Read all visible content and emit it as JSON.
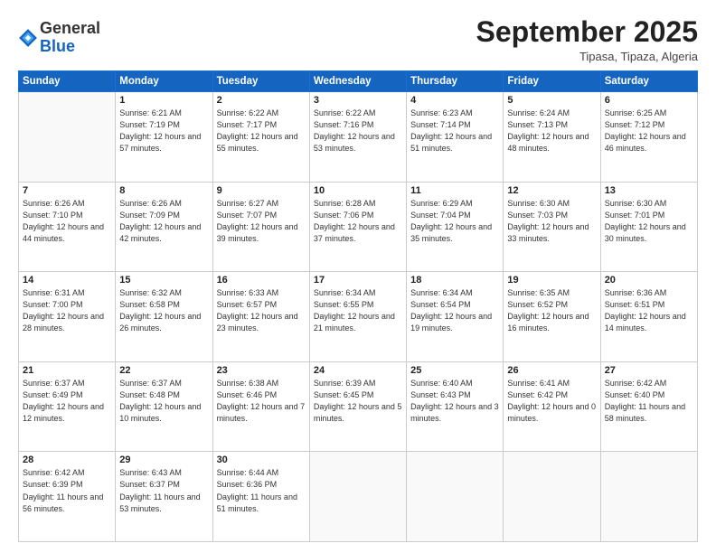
{
  "header": {
    "logo_general": "General",
    "logo_blue": "Blue",
    "month": "September 2025",
    "location": "Tipasa, Tipaza, Algeria"
  },
  "weekdays": [
    "Sunday",
    "Monday",
    "Tuesday",
    "Wednesday",
    "Thursday",
    "Friday",
    "Saturday"
  ],
  "weeks": [
    [
      {
        "day": "",
        "info": ""
      },
      {
        "day": "1",
        "info": "Sunrise: 6:21 AM\nSunset: 7:19 PM\nDaylight: 12 hours\nand 57 minutes."
      },
      {
        "day": "2",
        "info": "Sunrise: 6:22 AM\nSunset: 7:17 PM\nDaylight: 12 hours\nand 55 minutes."
      },
      {
        "day": "3",
        "info": "Sunrise: 6:22 AM\nSunset: 7:16 PM\nDaylight: 12 hours\nand 53 minutes."
      },
      {
        "day": "4",
        "info": "Sunrise: 6:23 AM\nSunset: 7:14 PM\nDaylight: 12 hours\nand 51 minutes."
      },
      {
        "day": "5",
        "info": "Sunrise: 6:24 AM\nSunset: 7:13 PM\nDaylight: 12 hours\nand 48 minutes."
      },
      {
        "day": "6",
        "info": "Sunrise: 6:25 AM\nSunset: 7:12 PM\nDaylight: 12 hours\nand 46 minutes."
      }
    ],
    [
      {
        "day": "7",
        "info": "Sunrise: 6:26 AM\nSunset: 7:10 PM\nDaylight: 12 hours\nand 44 minutes."
      },
      {
        "day": "8",
        "info": "Sunrise: 6:26 AM\nSunset: 7:09 PM\nDaylight: 12 hours\nand 42 minutes."
      },
      {
        "day": "9",
        "info": "Sunrise: 6:27 AM\nSunset: 7:07 PM\nDaylight: 12 hours\nand 39 minutes."
      },
      {
        "day": "10",
        "info": "Sunrise: 6:28 AM\nSunset: 7:06 PM\nDaylight: 12 hours\nand 37 minutes."
      },
      {
        "day": "11",
        "info": "Sunrise: 6:29 AM\nSunset: 7:04 PM\nDaylight: 12 hours\nand 35 minutes."
      },
      {
        "day": "12",
        "info": "Sunrise: 6:30 AM\nSunset: 7:03 PM\nDaylight: 12 hours\nand 33 minutes."
      },
      {
        "day": "13",
        "info": "Sunrise: 6:30 AM\nSunset: 7:01 PM\nDaylight: 12 hours\nand 30 minutes."
      }
    ],
    [
      {
        "day": "14",
        "info": "Sunrise: 6:31 AM\nSunset: 7:00 PM\nDaylight: 12 hours\nand 28 minutes."
      },
      {
        "day": "15",
        "info": "Sunrise: 6:32 AM\nSunset: 6:58 PM\nDaylight: 12 hours\nand 26 minutes."
      },
      {
        "day": "16",
        "info": "Sunrise: 6:33 AM\nSunset: 6:57 PM\nDaylight: 12 hours\nand 23 minutes."
      },
      {
        "day": "17",
        "info": "Sunrise: 6:34 AM\nSunset: 6:55 PM\nDaylight: 12 hours\nand 21 minutes."
      },
      {
        "day": "18",
        "info": "Sunrise: 6:34 AM\nSunset: 6:54 PM\nDaylight: 12 hours\nand 19 minutes."
      },
      {
        "day": "19",
        "info": "Sunrise: 6:35 AM\nSunset: 6:52 PM\nDaylight: 12 hours\nand 16 minutes."
      },
      {
        "day": "20",
        "info": "Sunrise: 6:36 AM\nSunset: 6:51 PM\nDaylight: 12 hours\nand 14 minutes."
      }
    ],
    [
      {
        "day": "21",
        "info": "Sunrise: 6:37 AM\nSunset: 6:49 PM\nDaylight: 12 hours\nand 12 minutes."
      },
      {
        "day": "22",
        "info": "Sunrise: 6:37 AM\nSunset: 6:48 PM\nDaylight: 12 hours\nand 10 minutes."
      },
      {
        "day": "23",
        "info": "Sunrise: 6:38 AM\nSunset: 6:46 PM\nDaylight: 12 hours\nand 7 minutes."
      },
      {
        "day": "24",
        "info": "Sunrise: 6:39 AM\nSunset: 6:45 PM\nDaylight: 12 hours\nand 5 minutes."
      },
      {
        "day": "25",
        "info": "Sunrise: 6:40 AM\nSunset: 6:43 PM\nDaylight: 12 hours\nand 3 minutes."
      },
      {
        "day": "26",
        "info": "Sunrise: 6:41 AM\nSunset: 6:42 PM\nDaylight: 12 hours\nand 0 minutes."
      },
      {
        "day": "27",
        "info": "Sunrise: 6:42 AM\nSunset: 6:40 PM\nDaylight: 11 hours\nand 58 minutes."
      }
    ],
    [
      {
        "day": "28",
        "info": "Sunrise: 6:42 AM\nSunset: 6:39 PM\nDaylight: 11 hours\nand 56 minutes."
      },
      {
        "day": "29",
        "info": "Sunrise: 6:43 AM\nSunset: 6:37 PM\nDaylight: 11 hours\nand 53 minutes."
      },
      {
        "day": "30",
        "info": "Sunrise: 6:44 AM\nSunset: 6:36 PM\nDaylight: 11 hours\nand 51 minutes."
      },
      {
        "day": "",
        "info": ""
      },
      {
        "day": "",
        "info": ""
      },
      {
        "day": "",
        "info": ""
      },
      {
        "day": "",
        "info": ""
      }
    ]
  ]
}
